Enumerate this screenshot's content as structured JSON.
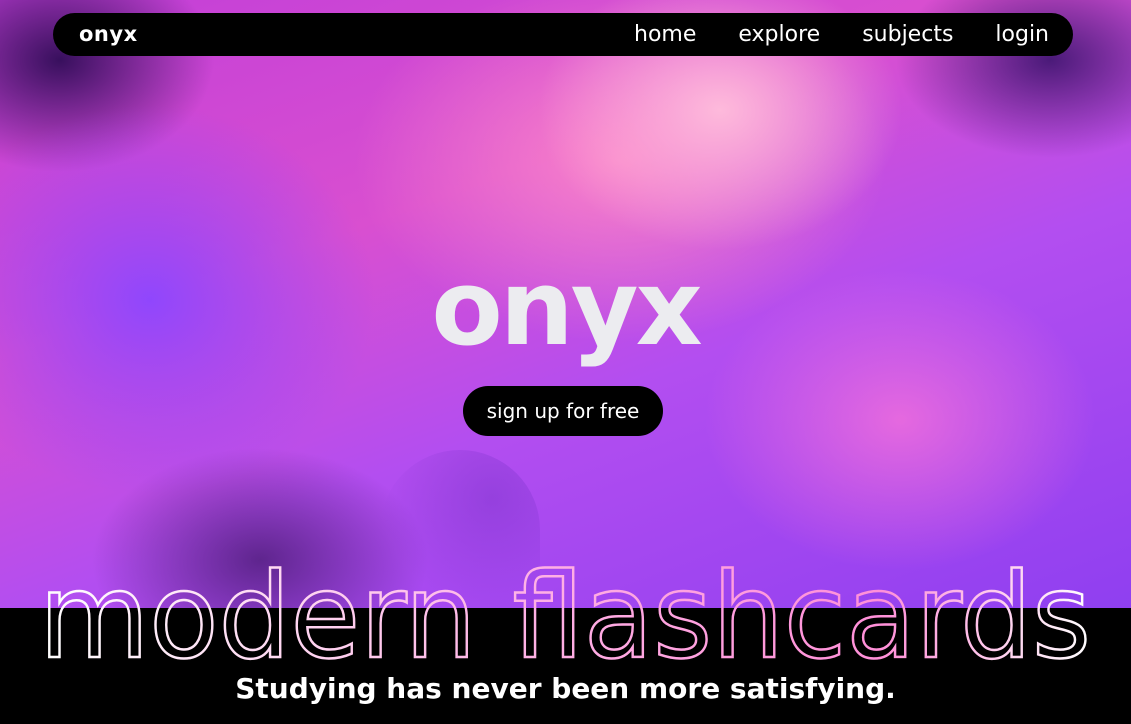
{
  "nav": {
    "logo": "onyx",
    "links": [
      {
        "label": "home"
      },
      {
        "label": "explore"
      },
      {
        "label": "subjects"
      },
      {
        "label": "login"
      }
    ]
  },
  "hero": {
    "title": "onyx",
    "cta_label": "sign up for free"
  },
  "banner": {
    "headline": "modern flashcards",
    "tagline": "Studying has never been more satisfying."
  },
  "colors": {
    "navbar_bg": "#000000",
    "text": "#ffffff",
    "gradient_pink": "#ff9ccf",
    "gradient_purple": "#8f3ff0"
  }
}
